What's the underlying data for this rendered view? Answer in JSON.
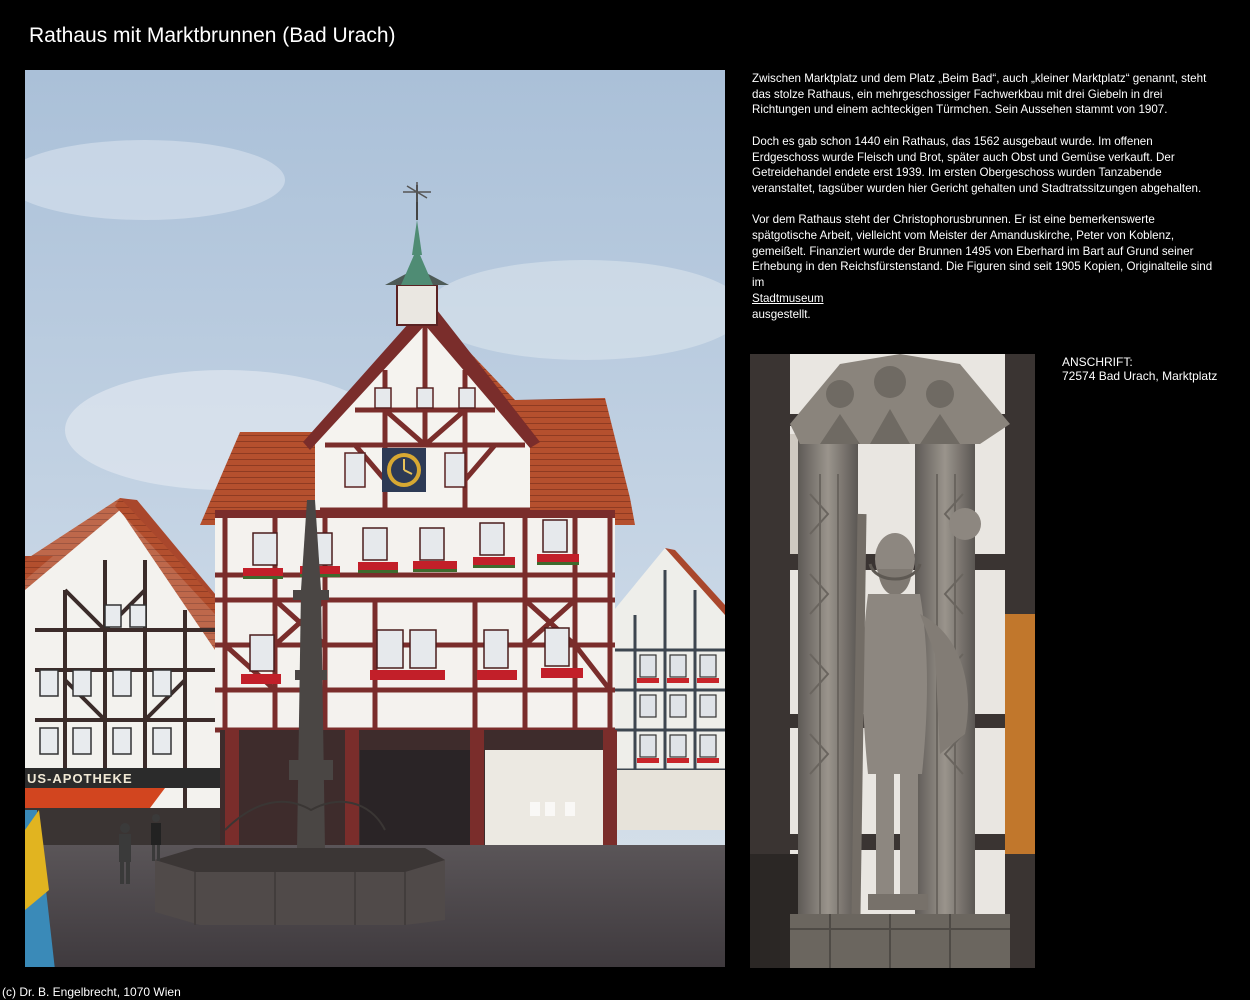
{
  "page": {
    "title": "Rathaus mit Marktbrunnen (Bad Urach)"
  },
  "description": {
    "p1": "Zwischen Marktplatz und dem Platz „Beim Bad“, auch „kleiner Marktplatz“ genannt, steht das stolze Rathaus, ein mehrgeschossiger Fachwerkbau mit drei Giebeln in drei Richtungen und einem achteckigen Türmchen. Sein Aussehen stammt von 1907.",
    "p2": "Doch es gab schon 1440 ein Rathaus, das 1562 ausgebaut wurde. Im offenen Erdgeschoss wurde Fleisch und Brot, später auch Obst und Gemüse verkauft. Der Getreidehandel endete erst 1939. Im ersten Obergeschoss wurden Tanzabende veranstaltet, tagsüber wurden hier Gericht gehalten und Stadtratssitzungen abgehalten.",
    "p3_before_link": "Vor dem Rathaus steht der Christophorusbrunnen. Er ist eine bemerkenswerte spätgotische Arbeit, vielleicht vom Meister der Amanduskirche, Peter von Koblenz, gemeißelt. Finanziert wurde der Brunnen 1495 von Eberhard im Bart auf Grund seiner Erhebung in den Reichsfürstenstand. Die Figuren sind seit 1905 Kopien, Originalteile sind im",
    "p3_link": "Stadtmuseum",
    "p3_after_link": "ausgestellt."
  },
  "address": {
    "label": "ANSCHRIFT:",
    "value": "72574 Bad Urach, Marktplatz"
  },
  "photo_main": {
    "shop_sign": "US-APOTHEKE"
  },
  "footer": {
    "copyright": "(c) Dr. B. Engelbrecht, 1070 Wien"
  }
}
